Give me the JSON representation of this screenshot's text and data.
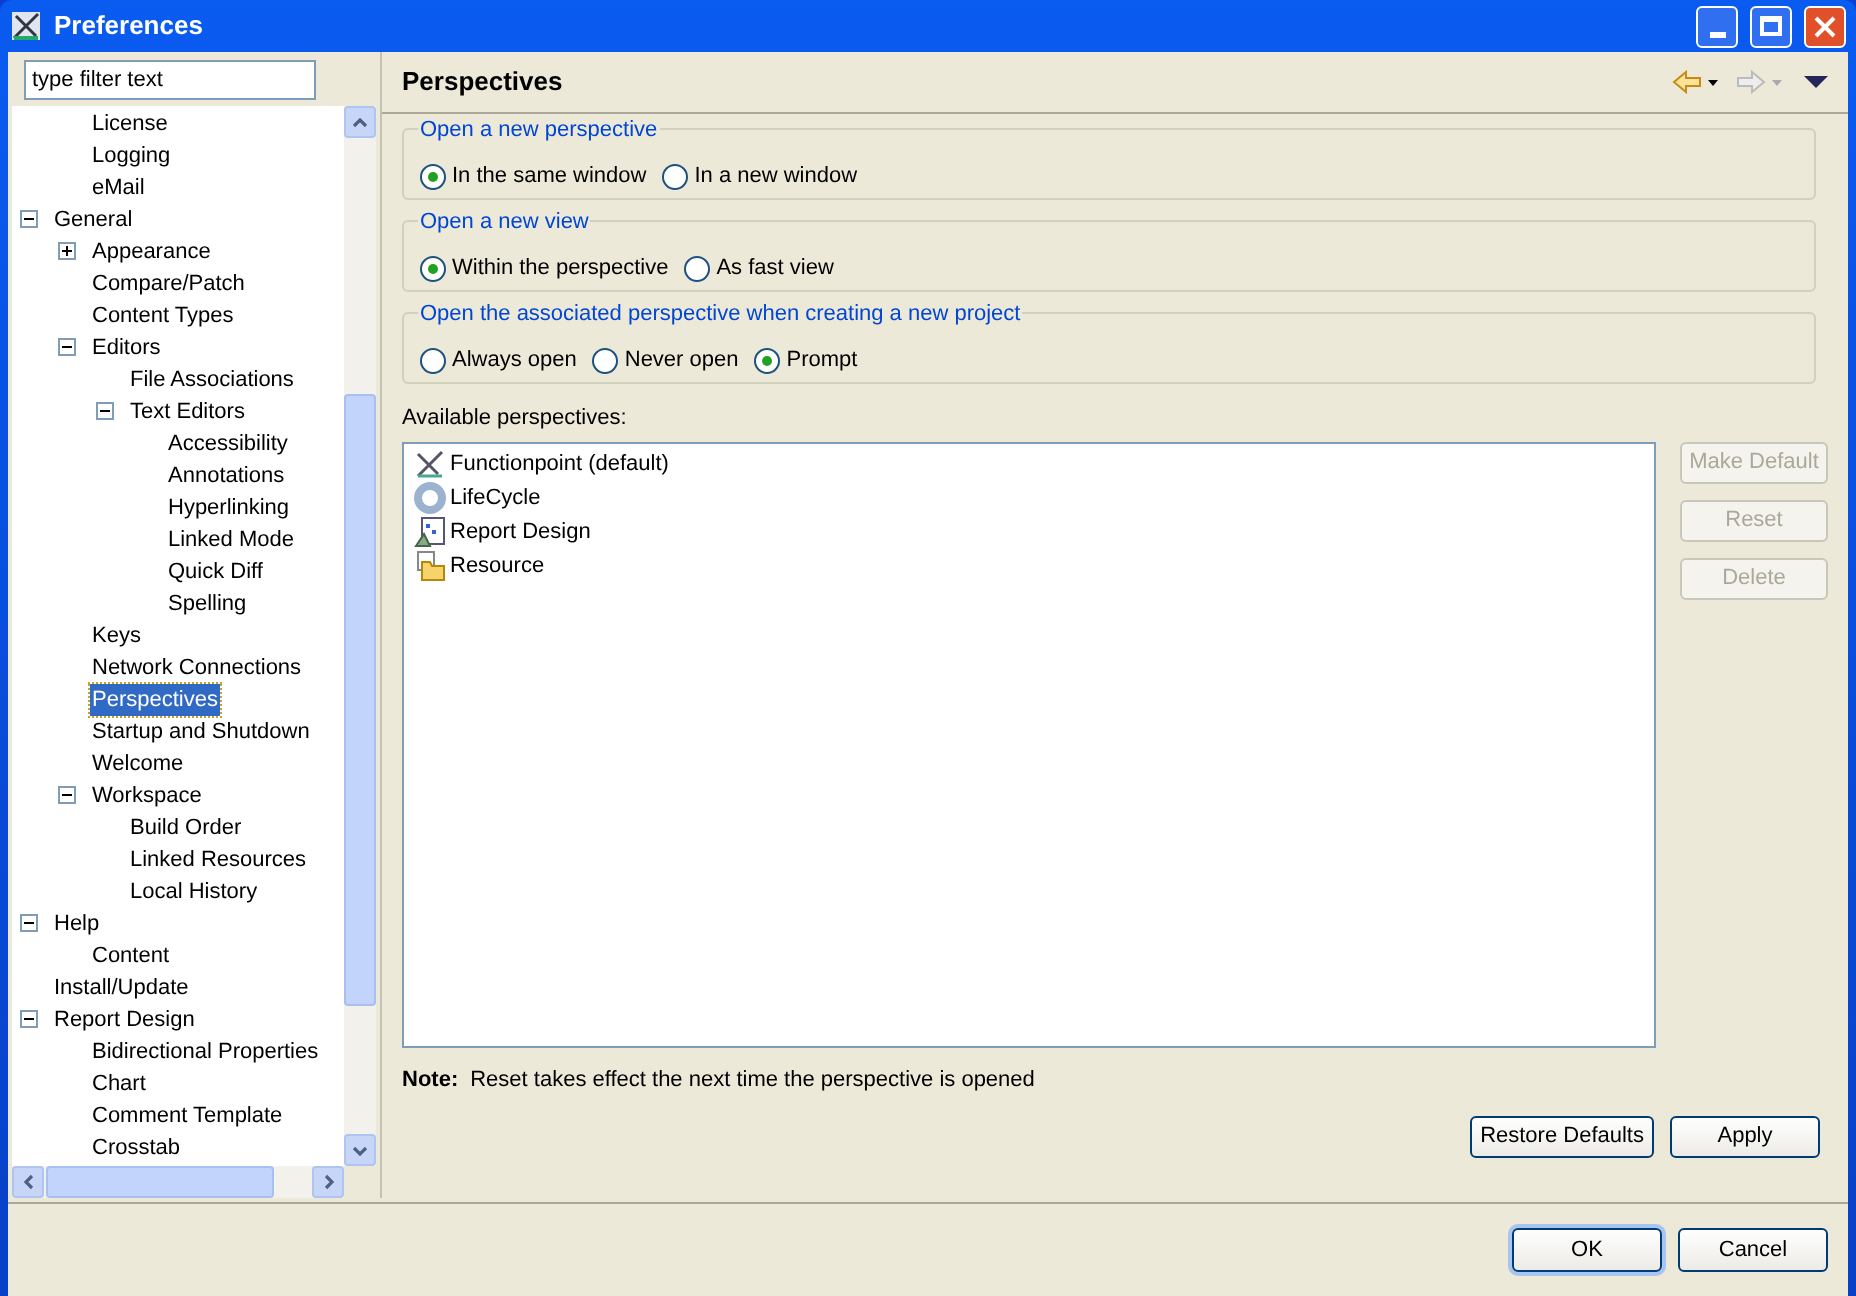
{
  "window": {
    "title": "Preferences"
  },
  "filter": {
    "value": "type filter text"
  },
  "tree": [
    {
      "children": [
        {
          "label": "License"
        },
        {
          "label": "Logging"
        },
        {
          "label": "eMail"
        }
      ]
    },
    {
      "label": "General",
      "expanded": true,
      "children": [
        {
          "label": "Appearance",
          "expanded": false
        },
        {
          "label": "Compare/Patch"
        },
        {
          "label": "Content Types"
        },
        {
          "label": "Editors",
          "expanded": true,
          "children": [
            {
              "label": "File Associations"
            },
            {
              "label": "Text Editors",
              "expanded": true,
              "children": [
                {
                  "label": "Accessibility"
                },
                {
                  "label": "Annotations"
                },
                {
                  "label": "Hyperlinking"
                },
                {
                  "label": "Linked Mode"
                },
                {
                  "label": "Quick Diff"
                },
                {
                  "label": "Spelling"
                }
              ]
            }
          ]
        },
        {
          "label": "Keys"
        },
        {
          "label": "Network Connections"
        },
        {
          "label": "Perspectives",
          "selected": true
        },
        {
          "label": "Startup and Shutdown"
        },
        {
          "label": "Welcome"
        },
        {
          "label": "Workspace",
          "expanded": true,
          "children": [
            {
              "label": "Build Order"
            },
            {
              "label": "Linked Resources"
            },
            {
              "label": "Local History"
            }
          ]
        }
      ]
    },
    {
      "label": "Help",
      "expanded": true,
      "children": [
        {
          "label": "Content"
        }
      ]
    },
    {
      "label": "Install/Update"
    },
    {
      "label": "Report Design",
      "expanded": true,
      "children": [
        {
          "label": "Bidirectional Properties"
        },
        {
          "label": "Chart"
        },
        {
          "label": "Comment Template"
        },
        {
          "label": "Crosstab"
        }
      ]
    }
  ],
  "page": {
    "title": "Perspectives"
  },
  "groups": [
    {
      "title": "Open a new perspective",
      "options": [
        {
          "label": "In the same window",
          "selected": true
        },
        {
          "label": "In a new window",
          "selected": false
        }
      ]
    },
    {
      "title": "Open a new view",
      "options": [
        {
          "label": "Within the perspective",
          "selected": true
        },
        {
          "label": "As fast view",
          "selected": false
        }
      ]
    },
    {
      "title": "Open the associated perspective when creating a new project",
      "options": [
        {
          "label": "Always open",
          "selected": false
        },
        {
          "label": "Never open",
          "selected": false
        },
        {
          "label": "Prompt",
          "selected": true
        }
      ]
    }
  ],
  "perspectives_label": "Available perspectives:",
  "perspectives": [
    {
      "label": "Functionpoint (default)"
    },
    {
      "label": "LifeCycle"
    },
    {
      "label": "Report Design"
    },
    {
      "label": "Resource"
    }
  ],
  "side_buttons": [
    {
      "label": "Make Default",
      "disabled": true
    },
    {
      "label": "Reset",
      "disabled": true
    },
    {
      "label": "Delete",
      "disabled": true
    }
  ],
  "note": {
    "label": "Note:",
    "text": "Reset takes effect the next time the perspective is opened"
  },
  "page_buttons": [
    "Restore Defaults",
    "Apply"
  ],
  "dialog_buttons": [
    {
      "label": "OK",
      "default": true
    },
    {
      "label": "Cancel",
      "default": false
    }
  ]
}
